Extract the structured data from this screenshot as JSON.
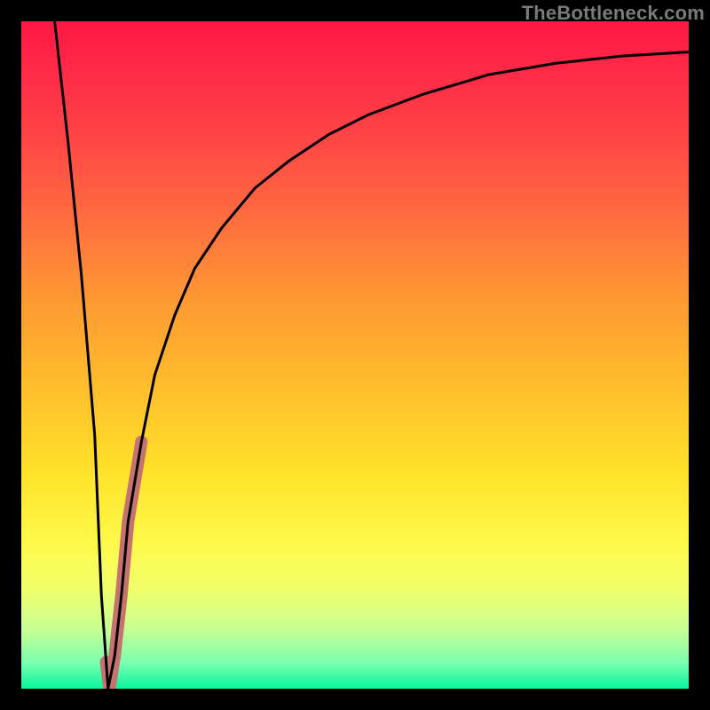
{
  "watermark": "TheBottleneck.com",
  "colors": {
    "frame": "#000000",
    "gradient_top": "#ff1846",
    "gradient_bottom": "#08f59c",
    "curve": "#000000",
    "highlight": "#c6736f"
  },
  "chart_data": {
    "type": "line",
    "title": "",
    "xlabel": "",
    "ylabel": "",
    "xlim": [
      0,
      100
    ],
    "ylim": [
      0,
      100
    ],
    "curve": {
      "name": "v-curve",
      "x": [
        5,
        7,
        9,
        11,
        12,
        13,
        14,
        15,
        16,
        18,
        20,
        23,
        26,
        30,
        35,
        40,
        46,
        52,
        60,
        70,
        80,
        90,
        100
      ],
      "y": [
        100,
        82,
        62,
        38,
        14,
        0,
        5,
        14,
        25,
        37,
        47,
        56,
        63,
        69,
        75,
        79,
        83,
        86,
        89,
        92,
        93.7,
        94.8,
        95.4
      ]
    },
    "highlight_segment": {
      "name": "salmon-stroke",
      "x": [
        12.7,
        13.2,
        14.0,
        15.0,
        16.0,
        17.0,
        18.0
      ],
      "y": [
        4.0,
        0.0,
        5.0,
        14.0,
        25.0,
        31.0,
        37.0
      ]
    }
  }
}
